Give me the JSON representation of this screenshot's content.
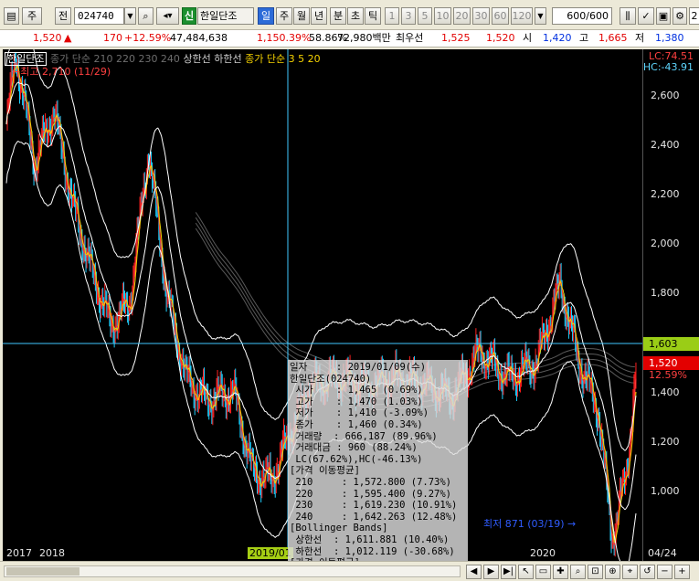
{
  "toolbar": {
    "menu_label": "주",
    "prev_label": "전",
    "stock_code": "024740",
    "badge": "신",
    "stock_name": "한일단조",
    "period_buttons": [
      "일",
      "주",
      "월",
      "년",
      "분",
      "초",
      "틱"
    ],
    "interval_buttons": [
      "1",
      "3",
      "5",
      "10",
      "20",
      "30",
      "60",
      "120"
    ],
    "count_value": "600",
    "count_total": "/600",
    "trailing": "2"
  },
  "quote": {
    "price": "1,520",
    "arrow": "▲",
    "change": "170",
    "change_pct": "+12.59%",
    "volume": "47,484,638",
    "volume_pct": "1,150.39%",
    "turnover_pct": "58.86%",
    "amount": "72,980백만",
    "pref_label": "최우선",
    "ask": "1,525",
    "bid": "1,520",
    "open_label": "시",
    "open": "1,420",
    "high_label": "고",
    "high": "1,665",
    "low_label": "저",
    "low": "1,380"
  },
  "legend": {
    "stock": "한일단조",
    "faded": "종가 단순 210  220  230  240",
    "bands": "상한선  하한선",
    "ma": "종가 단순 3  5  20"
  },
  "chart_labels": {
    "high_marker": "←최고 2,710 (11/29)",
    "low_marker": "최저 871 (03/19) →",
    "lc": "LC:74.51",
    "hc": "HC:-43.91",
    "current_price": "1,520",
    "current_pct": "12.59%",
    "crosshair_price": "1,603"
  },
  "chart_data": {
    "type": "candlestick",
    "y_ticks": [
      "2,600",
      "2,400",
      "2,200",
      "2,000",
      "1,800",
      "1,400",
      "1,200",
      "1,000"
    ],
    "ylim": [
      870,
      2720
    ],
    "x_labels": [
      "2017",
      "2018",
      "2019/01",
      "2020",
      "04/24"
    ],
    "crosshair_date_label": "2019/01",
    "series": [
      {
        "name": "종가 단순 3",
        "color": "#ff3b3b"
      },
      {
        "name": "종가 단순 5",
        "color": "#f5d200"
      },
      {
        "name": "종가 단순 20",
        "color": "#ffffff"
      },
      {
        "name": "상한선",
        "color": "#ffffff"
      },
      {
        "name": "하한선",
        "color": "#ffffff"
      }
    ]
  },
  "popup": {
    "rows": [
      "일자     : 2019/01/09(수)",
      "한일단조(024740)",
      " 시가    : 1,465 (0.69%)",
      " 고가    : 1,470 (1.03%)",
      " 저가    : 1,410 (-3.09%)",
      " 종가    : 1,460 (0.34%)",
      " 거래량  : 666,187 (89.96%)",
      " 거래대금 : 960 (88.24%)",
      " LC(67.62%),HC(-46.13%)",
      "[가격 이동평균]",
      " 210     : 1,572.800 (7.73%)",
      " 220     : 1,595.400 (9.27%)",
      " 230     : 1,619.230 (10.91%)",
      " 240     : 1,642.263 (12.48%)",
      "[Bollinger Bands]",
      " 상한선  : 1,611.881 (10.40%)",
      " 하한선  : 1,012.119 (-30.68%)",
      "[가격 이동평균]"
    ]
  }
}
